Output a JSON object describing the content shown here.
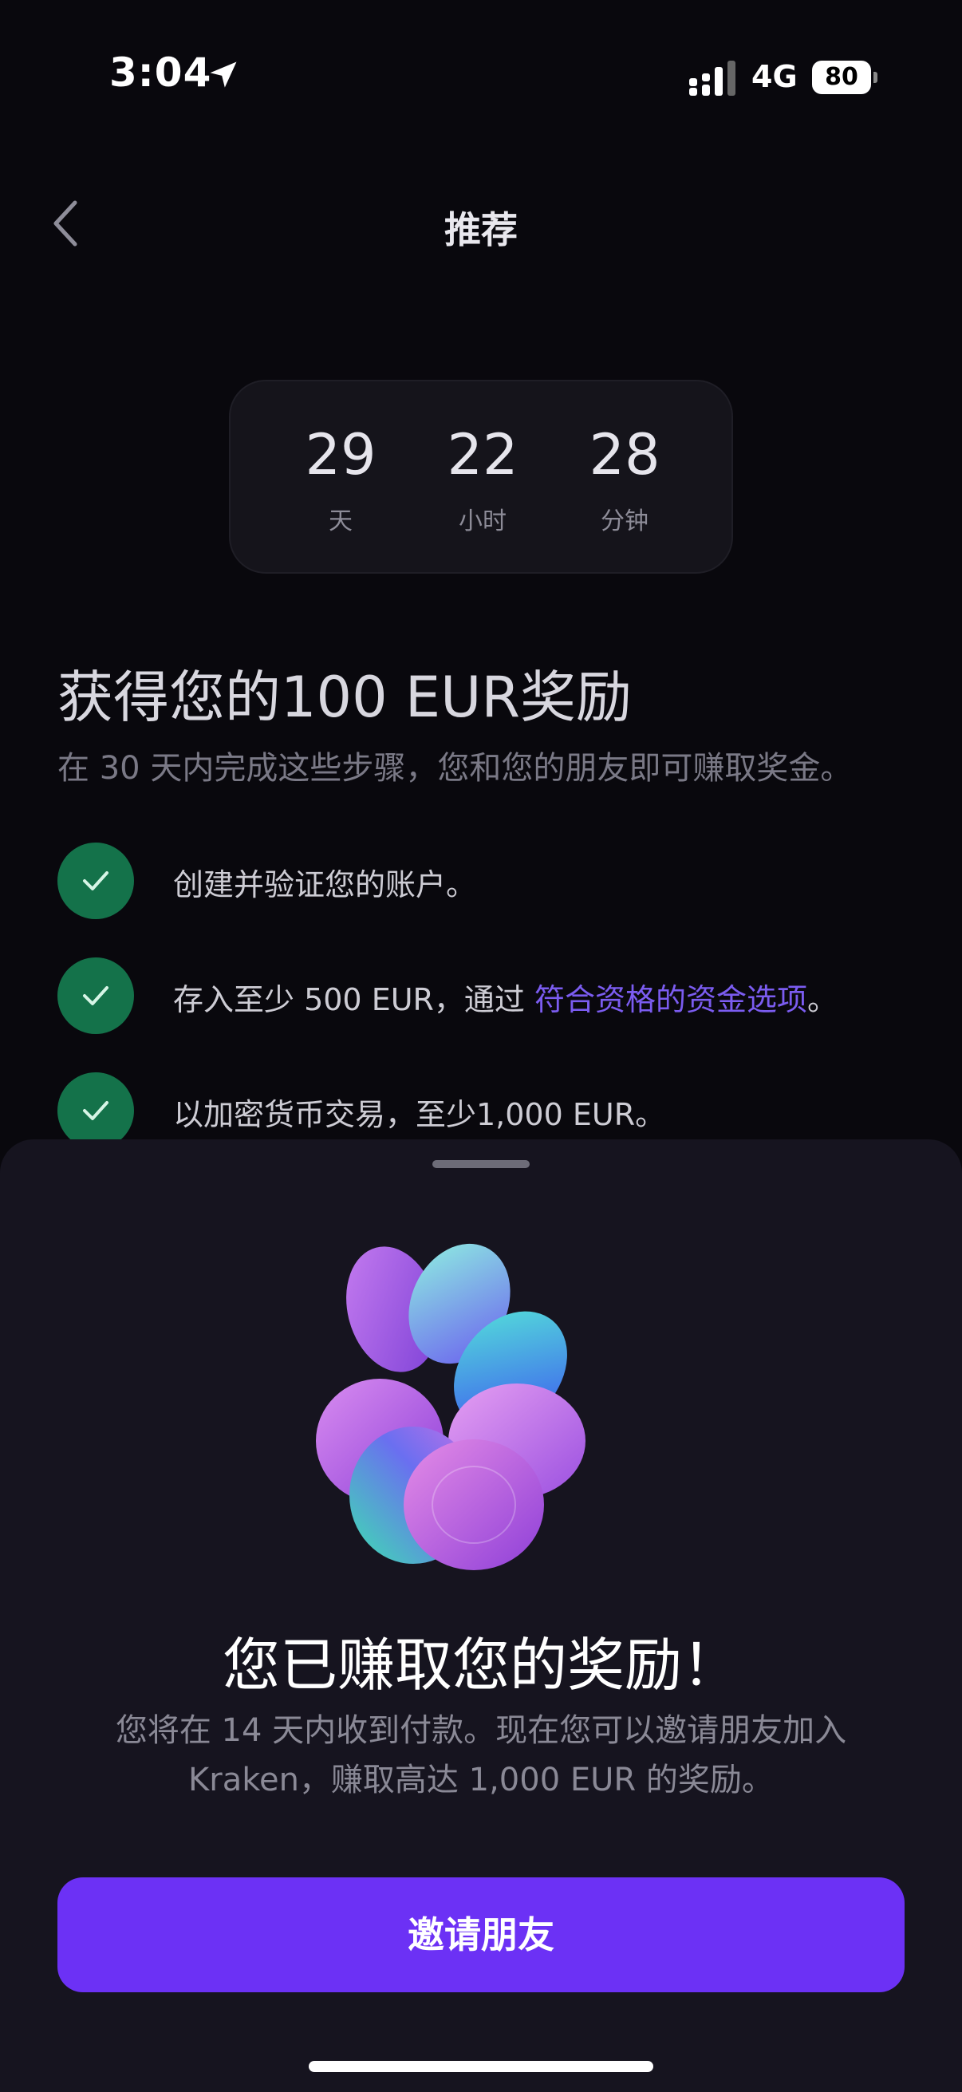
{
  "status_bar": {
    "time": "3:04",
    "network": "4G",
    "battery": "80"
  },
  "nav": {
    "title": "推荐"
  },
  "countdown": [
    {
      "value": "29",
      "label": "天"
    },
    {
      "value": "22",
      "label": "小时"
    },
    {
      "value": "28",
      "label": "分钟"
    }
  ],
  "reward": {
    "heading": "获得您的100 EUR奖励",
    "subtitle": "在 30 天内完成这些步骤，您和您的朋友即可赚取奖金。"
  },
  "steps": [
    {
      "text": "创建并验证您的账户。"
    },
    {
      "text_before": "存入至少 500 EUR，通过 ",
      "link": "符合资格的资金选项",
      "text_after": "。"
    },
    {
      "text": "以加密货币交易，至少1,000 EUR。"
    }
  ],
  "sheet": {
    "title": "您已赚取您的奖励！",
    "description": "您将在 14 天内收到付款。现在您可以邀请朋友加入 Kraken，赚取高达 1,000 EUR 的奖励。",
    "button": "邀请朋友"
  },
  "colors": {
    "accent": "#6c31f5",
    "link": "#7b5cf0",
    "check": "#14724a"
  }
}
